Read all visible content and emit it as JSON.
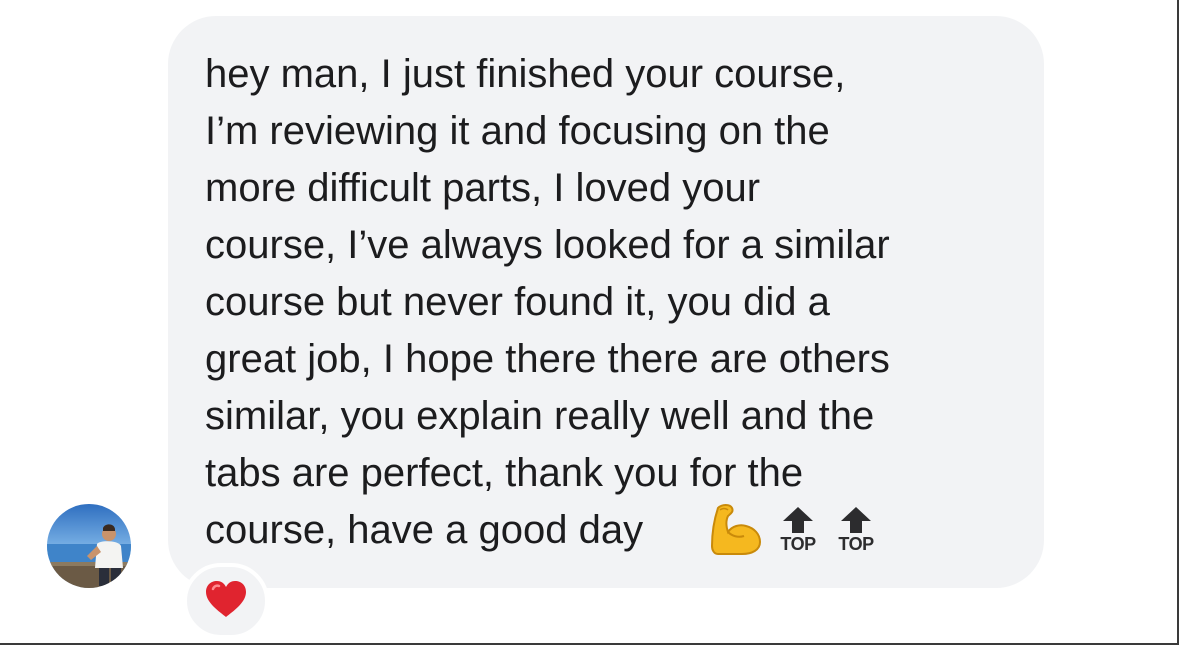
{
  "message": {
    "lines": [
      "hey man, I just finished your course,",
      "I’m reviewing it and focusing on the",
      "more difficult parts, I loved your",
      "course, I’ve always looked for a similar",
      "course but never found it, you did a",
      "great job, I hope there there are others",
      "similar, you explain really well and the",
      "tabs are perfect, thank you for the",
      "course, have a good day"
    ],
    "trailing_emojis": [
      {
        "icon": "flexed-biceps-icon"
      },
      {
        "icon": "top-arrow-icon",
        "label": "TOP"
      },
      {
        "icon": "top-arrow-icon",
        "label": "TOP"
      }
    ]
  },
  "reaction": {
    "icon": "red-heart-icon"
  },
  "sender": {
    "icon": "avatar-photo"
  },
  "colors": {
    "bubble": "#f2f3f5",
    "text": "#1c1c1e",
    "heart": "#e0242f",
    "biceps": "#f5b81f"
  }
}
